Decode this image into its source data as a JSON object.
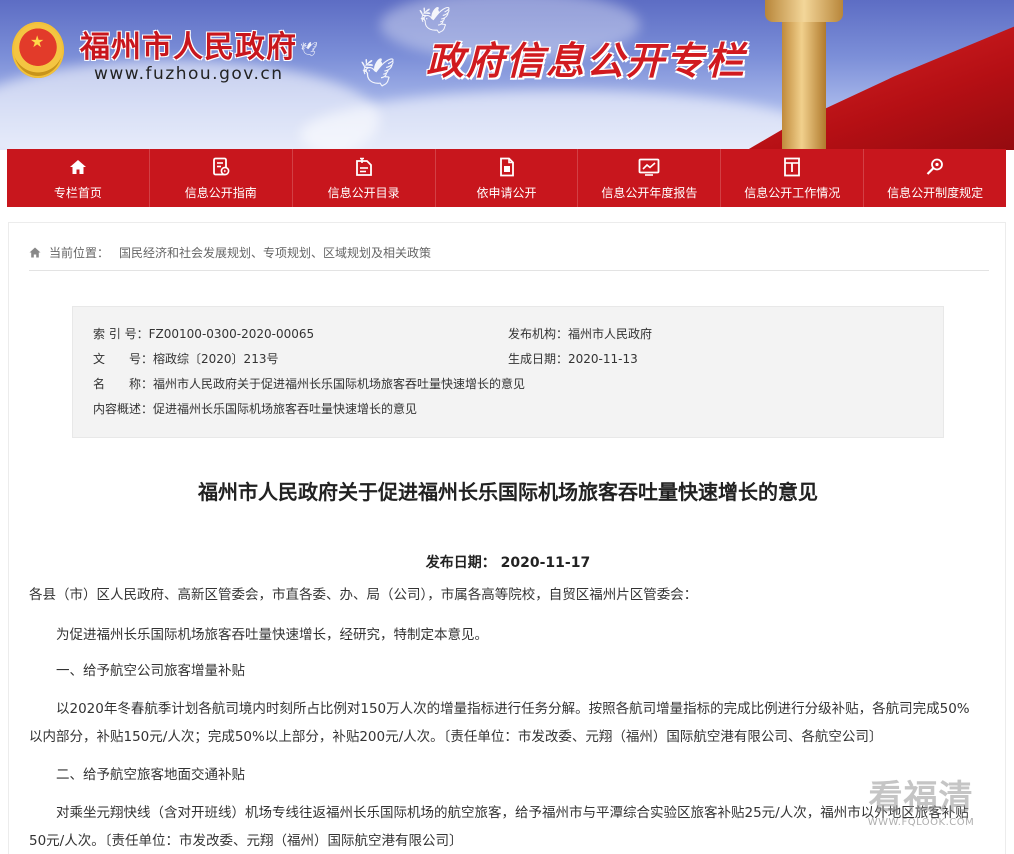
{
  "header": {
    "site_title": "福州市人民政府",
    "site_url": "www.fuzhou.gov.cn",
    "slogan": "政府信息公开专栏"
  },
  "nav": [
    {
      "label": "专栏首页",
      "icon": "home-icon"
    },
    {
      "label": "信息公开指南",
      "icon": "guide-icon"
    },
    {
      "label": "信息公开目录",
      "icon": "catalog-icon"
    },
    {
      "label": "依申请公开",
      "icon": "document-icon"
    },
    {
      "label": "信息公开年度报告",
      "icon": "report-icon"
    },
    {
      "label": "信息公开工作情况",
      "icon": "work-status-icon"
    },
    {
      "label": "信息公开制度规定",
      "icon": "regulation-search-icon"
    }
  ],
  "breadcrumb": {
    "prefix": "当前位置：",
    "items": [
      "国民经济和社会发展规划、专项规划、区域规划及相关政策"
    ]
  },
  "meta": {
    "index_label": "索 引 号：",
    "index_value": "FZ00100-0300-2020-00065",
    "doc_no_label": "文　　号：",
    "doc_no_value": "榕政综〔2020〕213号",
    "name_label": "名　　称：",
    "name_value": "福州市人民政府关于促进福州长乐国际机场旅客吞吐量快速增长的意见",
    "summary_label": "内容概述：",
    "summary_value": "促进福州长乐国际机场旅客吞吐量快速增长的意见",
    "publisher_label": "发布机构：",
    "publisher_value": "福州市人民政府",
    "created_label": "生成日期：",
    "created_value": "2020-11-13"
  },
  "article": {
    "title": "福州市人民政府关于促进福州长乐国际机场旅客吞吐量快速增长的意见",
    "pub_date": "发布日期：  2020-11-17",
    "paragraphs": [
      "各县（市）区人民政府、高新区管委会，市直各委、办、局（公司），市属各高等院校，自贸区福州片区管委会：",
      "为促进福州长乐国际机场旅客吞吐量快速增长，经研究，特制定本意见。",
      "一、给予航空公司旅客增量补贴",
      "以2020年冬春航季计划各航司境内时刻所占比例对150万人次的增量指标进行任务分解。按照各航司增量指标的完成比例进行分级补贴，各航司完成50%以内部分，补贴150元/人次；完成50%以上部分，补贴200元/人次。〔责任单位：市发改委、元翔（福州）国际航空港有限公司、各航空公司〕",
      "二、给予航空旅客地面交通补贴",
      "对乘坐元翔快线（含对开班线）机场专线往返福州长乐国际机场的航空旅客，给予福州市与平潭综合实验区旅客补贴25元/人次，福州市以外地区旅客补贴50元/人次。〔责任单位：市发改委、元翔（福州）国际航空港有限公司〕"
    ]
  },
  "watermark": {
    "text": "看福清",
    "url": "WWW.FQLOOK.COM"
  }
}
